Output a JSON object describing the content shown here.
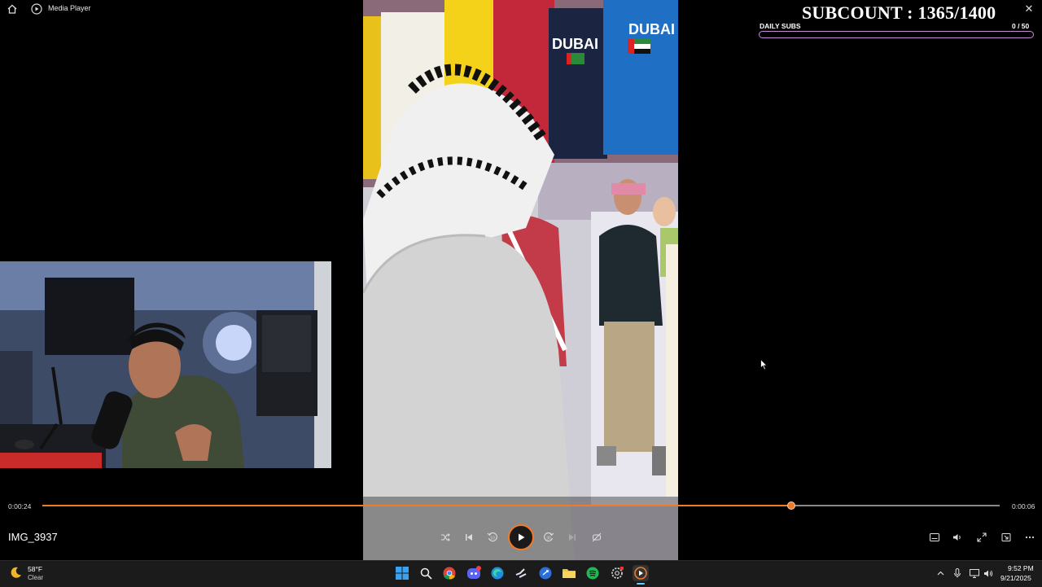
{
  "titlebar": {
    "app_title": "Media Player",
    "close_glyph": "✕"
  },
  "overlay": {
    "subcount": "SUBCOUNT : 1365/1400",
    "daily_label": "DAILY SUBS",
    "daily_count": "0  / 50"
  },
  "player": {
    "current_time": "0:00:24",
    "total_time": "0:00:06",
    "progress_fraction": 0.782,
    "file_name": "IMG_3937",
    "controls": [
      "shuffle-icon",
      "previous-icon",
      "rewind-10-icon",
      "play-icon",
      "forward-30-icon",
      "next-icon",
      "repeat-off-icon"
    ],
    "right_controls": [
      "subtitles-icon",
      "volume-icon",
      "fullscreen-icon",
      "miniplayer-icon",
      "more-icon"
    ],
    "accent": "#f0792a"
  },
  "taskbar": {
    "weather": {
      "temp": "58°F",
      "condition": "Clear",
      "icon": "moon-icon"
    },
    "apps": [
      "windows-start-icon",
      "search-icon",
      "chrome-icon",
      "discord-icon",
      "edge-icon",
      "steam-icon",
      "generic-app-icon",
      "file-explorer-icon",
      "spotify-icon",
      "settings-icon",
      "media-player-icon"
    ],
    "clock": {
      "time": "9:52 PM",
      "date": "9/21/2025"
    }
  }
}
